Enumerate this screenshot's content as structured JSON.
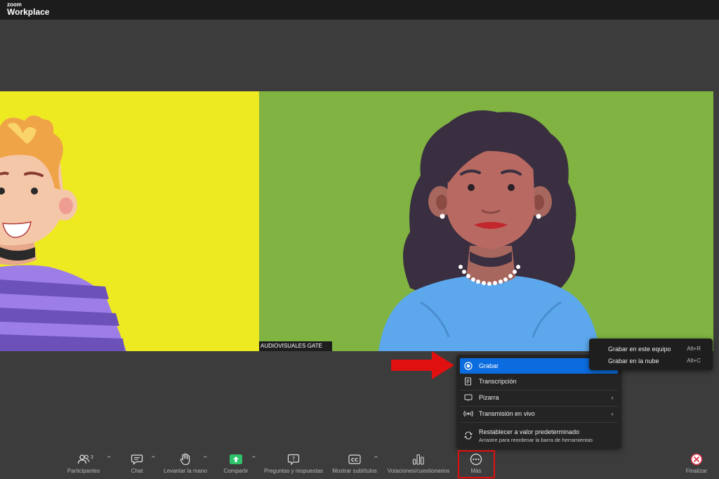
{
  "app": {
    "brand_top": "zoom",
    "brand_main": "Workplace"
  },
  "video": {
    "participant_name": "AUDIOVISUALES GATE",
    "left_tile_color": "#eeea21",
    "right_tile_color": "#80b341"
  },
  "more_menu": {
    "items": [
      {
        "label": "Grabar",
        "icon": "record-icon",
        "active": true
      },
      {
        "label": "Transcripción",
        "icon": "transcript-icon"
      },
      {
        "label": "Pizarra",
        "icon": "whiteboard-icon",
        "submenu": true
      },
      {
        "label": "Transmisión en vivo",
        "icon": "live-stream-icon",
        "submenu": true
      }
    ],
    "reset": {
      "label": "Restablecer a valor predeterminado",
      "sublabel": "Arrastre para reordenar la barra de herramientas",
      "icon": "reset-icon"
    }
  },
  "record_submenu": {
    "items": [
      {
        "label": "Grabar en este equipo",
        "shortcut": "Alt+R"
      },
      {
        "label": "Grabar en la nube",
        "shortcut": "Alt+C"
      }
    ]
  },
  "toolbar": {
    "participants_label": "Participantes",
    "participants_count": "3",
    "chat_label": "Chat",
    "raise_hand_label": "Levantar la mano",
    "share_label": "Compartir",
    "qa_label": "Preguntas y respuestas",
    "captions_label": "Mostrar subtítulos",
    "polls_label": "Votaciones/cuestionarios",
    "more_label": "Más",
    "end_label": "Finalizar"
  },
  "colors": {
    "accent": "#0b6ce0",
    "share_green": "#2fc26b",
    "end_red": "#e0334a",
    "arrow_red": "#e01010"
  }
}
